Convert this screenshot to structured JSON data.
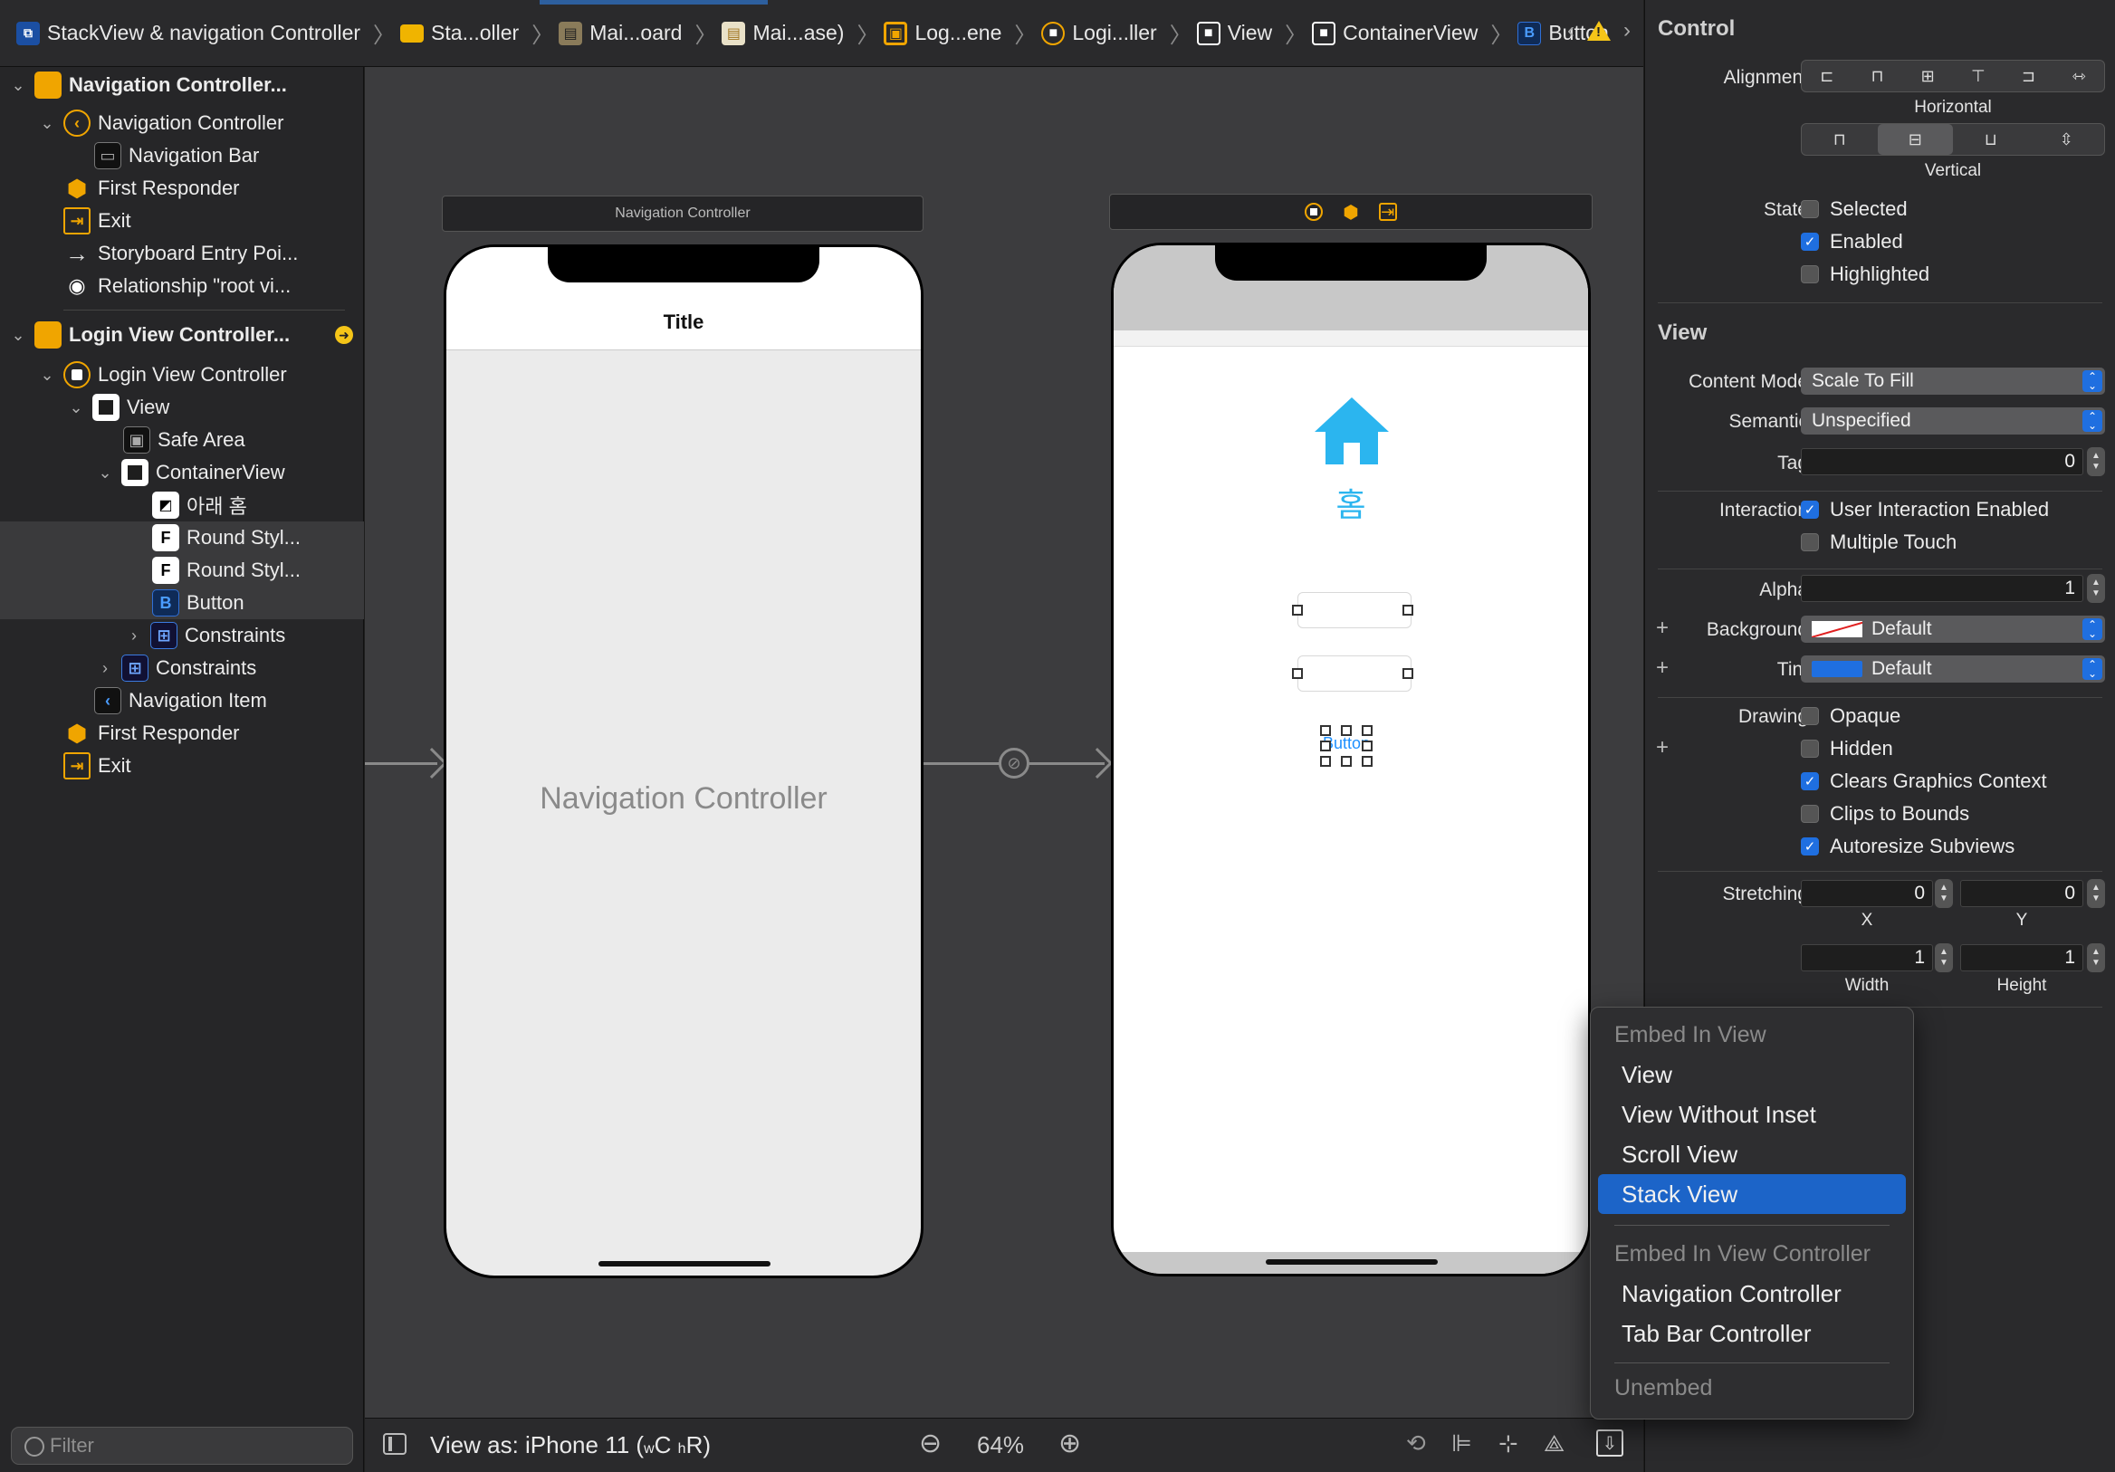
{
  "breadcrumb": {
    "items": [
      "StackView & navigation Controller",
      "Sta...oller",
      "Mai...oard",
      "Mai...ase)",
      "Log...ene",
      "Logi...ller",
      "View",
      "ContainerView",
      "Button"
    ]
  },
  "outline": {
    "nav_scene": "Navigation Controller...",
    "nav_controller": "Navigation Controller",
    "nav_bar": "Navigation Bar",
    "first_responder_1": "First Responder",
    "exit_1": "Exit",
    "entry_point": "Storyboard Entry Poi...",
    "relationship": "Relationship \"root vi...",
    "login_scene": "Login View Controller...",
    "login_vc": "Login View Controller",
    "view": "View",
    "safe_area": "Safe Area",
    "container_view": "ContainerView",
    "image_item": "아래 홈",
    "round_style_1": "Round Styl...",
    "round_style_2": "Round Styl...",
    "button": "Button",
    "constraints_inner": "Constraints",
    "constraints_outer": "Constraints",
    "nav_item": "Navigation Item",
    "first_responder_2": "First Responder",
    "exit_2": "Exit",
    "filter_placeholder": "Filter"
  },
  "canvas": {
    "nav_scene_bar": "Navigation Controller",
    "nav_phone_title": "Title",
    "nav_placeholder": "Navigation Controller",
    "login_label": "홈",
    "login_button": "Button",
    "colors": {
      "home_icon": "#2bb5ef",
      "selection": "#1e90ff"
    }
  },
  "bottombar": {
    "view_as": "View as: iPhone 11 (",
    "size_w": "w",
    "size_c": "C",
    "size_h": "h",
    "size_r": "R",
    "close_paren": ")",
    "zoom": "64%"
  },
  "inspector": {
    "control_title": "Control",
    "alignment_label": "Alignment",
    "horizontal_caption": "Horizontal",
    "vertical_caption": "Vertical",
    "state_label": "State",
    "state_selected": "Selected",
    "state_enabled": "Enabled",
    "state_highlighted": "Highlighted",
    "view_title": "View",
    "content_mode_label": "Content Mode",
    "content_mode_value": "Scale To Fill",
    "semantic_label": "Semantic",
    "semantic_value": "Unspecified",
    "tag_label": "Tag",
    "tag_value": "0",
    "interaction_label": "Interaction",
    "user_interaction": "User Interaction Enabled",
    "multiple_touch": "Multiple Touch",
    "alpha_label": "Alpha",
    "alpha_value": "1",
    "background_label": "Background",
    "background_value": "Default",
    "tint_label": "Tint",
    "tint_value": "Default",
    "drawing_label": "Drawing",
    "opaque": "Opaque",
    "hidden": "Hidden",
    "clears_graphics": "Clears Graphics Context",
    "clips_bounds": "Clips to Bounds",
    "autoresize": "Autoresize Subviews",
    "stretching_label": "Stretching",
    "stretch_x": "0",
    "stretch_y": "0",
    "stretch_w": "1",
    "stretch_h": "1",
    "x_caption": "X",
    "y_caption": "Y",
    "width_caption": "Width",
    "height_caption": "Height",
    "tint_color": "#1f6fe0"
  },
  "menu": {
    "embed_view_header": "Embed In View",
    "item_view": "View",
    "item_view_no_inset": "View Without Inset",
    "item_scroll": "Scroll View",
    "item_stack": "Stack View",
    "embed_vc_header": "Embed In View Controller",
    "item_nav": "Navigation Controller",
    "item_tab": "Tab Bar Controller",
    "unembed": "Unembed"
  }
}
